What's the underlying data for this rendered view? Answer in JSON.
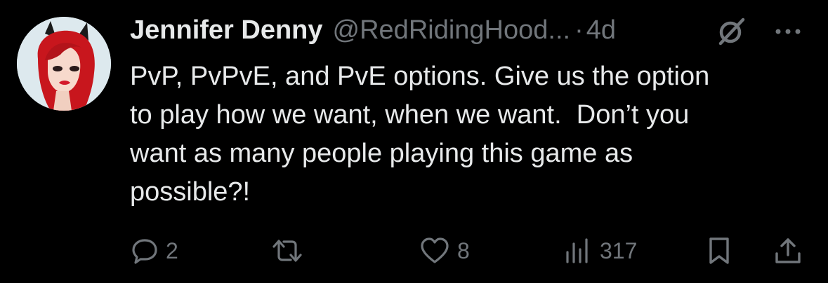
{
  "tweet": {
    "display_name": "Jennifer Denny",
    "handle": "@RedRidingHood...",
    "separator": "·",
    "timestamp": "4d",
    "text": "PvP, PvPvE, and PvE options. Give us the option\nto play how we want, when we want.  Don’t you\nwant as many people playing this game as\npossible?!",
    "avatar_background": "#dde9ee",
    "avatar_hair_color": "#c8161d"
  },
  "actions": {
    "reply": {
      "icon": "reply-icon",
      "count": "2"
    },
    "repost": {
      "icon": "repost-icon",
      "count": ""
    },
    "like": {
      "icon": "heart-icon",
      "count": "8"
    },
    "views": {
      "icon": "views-icon",
      "count": "317"
    },
    "bookmark": {
      "icon": "bookmark-icon"
    },
    "share": {
      "icon": "share-icon"
    }
  },
  "header_icons": [
    "grok-icon",
    "more-icon"
  ],
  "colors": {
    "background": "#000000",
    "primary_text": "#e7e9ea",
    "secondary_text": "#71767b"
  }
}
